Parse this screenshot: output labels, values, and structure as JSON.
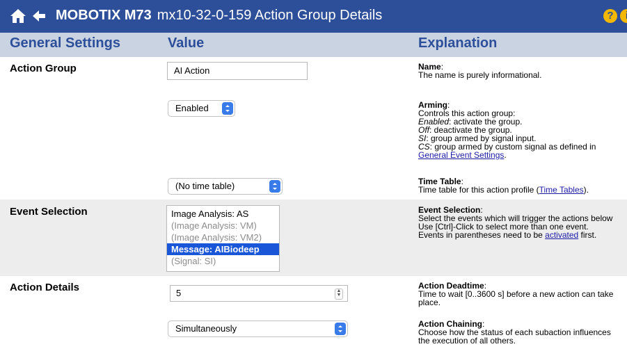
{
  "title": {
    "brand": "MOBOTIX M73",
    "text": "mx10-32-0-159 Action Group Details"
  },
  "columns": {
    "settings": "General Settings",
    "value": "Value",
    "explanation": "Explanation"
  },
  "action_group": {
    "label": "Action Group",
    "name_value": "AI Action",
    "arming_value": "Enabled",
    "time_table_value": "(No time table)"
  },
  "event_selection": {
    "label": "Event Selection",
    "options": [
      "Image Analysis: AS",
      "(Image Analysis: VM)",
      "(Image Analysis: VM2)",
      "Message: AIBiodeep",
      "(Signal: SI)"
    ]
  },
  "action_details": {
    "label": "Action Details",
    "deadtime_value": "5",
    "chaining_value": "Simultaneously"
  },
  "explanations": {
    "name": {
      "title": "Name",
      "line1": "The name is purely informational."
    },
    "arming": {
      "title": "Arming",
      "line1": "Controls this action group:",
      "enabled_term": "Enabled",
      "enabled_text": ": activate the group.",
      "off_term": "Off",
      "off_text": ": deactivate the group.",
      "si_term": "SI",
      "si_text": ": group armed by signal input.",
      "cs_term": "CS",
      "cs_text": ": group armed by custom signal as defined in",
      "link": "General Event Settings",
      "link_tail": "."
    },
    "time_table": {
      "title": "Time Table",
      "text": "Time table for this action profile (",
      "link": "Time Tables",
      "tail": ")."
    },
    "event_selection": {
      "title": "Event Selection",
      "line1": "Select the events which will trigger the actions below",
      "line2": "Use [Ctrl]-Click to select more than one event.",
      "line3_pre": "Events in parentheses need to be ",
      "line3_link": "activated",
      "line3_post": " first."
    },
    "deadtime": {
      "title": "Action Deadtime",
      "line1": "Time to wait [0..3600 s] before a new action can take",
      "line2": "place."
    },
    "chaining": {
      "title": "Action Chaining",
      "line1": "Choose how the status of each subaction influences",
      "line2": "the execution of all others."
    }
  },
  "colors": {
    "title_bar": "#2d4f9a",
    "header_row": "#c9d3e2",
    "row_shade": "#ededed",
    "selection": "#1a57d8",
    "accent_icon": "#f5b800"
  }
}
